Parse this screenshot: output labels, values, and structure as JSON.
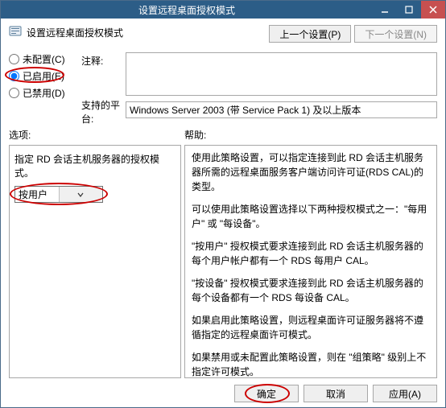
{
  "titlebar": {
    "title": "设置远程桌面授权模式"
  },
  "header": {
    "title": "设置远程桌面授权模式",
    "prev_btn": "上一个设置(P)",
    "next_btn": "下一个设置(N)"
  },
  "config": {
    "not_configured": "未配置(C)",
    "enabled": "已启用(E)",
    "disabled": "已禁用(D)",
    "comment_label": "注释:",
    "platform_label": "支持的平台:",
    "platform_value": "Windows Server 2003 (带 Service Pack 1) 及以上版本"
  },
  "mid": {
    "options_label": "选项:",
    "help_label": "帮助:"
  },
  "options": {
    "label": "指定 RD 会话主机服务器的授权模式。",
    "selected": "按用户"
  },
  "help": {
    "p1": "使用此策略设置，可以指定连接到此 RD 会话主机服务器所需的远程桌面服务客户端访问许可证(RDS CAL)的类型。",
    "p2": "可以使用此策略设置选择以下两种授权模式之一：\"每用户\" 或 \"每设备\"。",
    "p3": "\"按用户\" 授权模式要求连接到此 RD 会话主机服务器的每个用户帐户都有一个 RDS 每用户 CAL。",
    "p4": "\"按设备\" 授权模式要求连接到此 RD 会话主机服务器的每个设备都有一个 RDS 每设备 CAL。",
    "p5": "如果启用此策略设置，则远程桌面许可证服务器将不遵循指定的远程桌面许可模式。",
    "p6": "如果禁用或未配置此策略设置，则在 \"组策略\" 级别上不指定许可模式。"
  },
  "footer": {
    "ok": "确定",
    "cancel": "取消",
    "apply": "应用(A)"
  }
}
